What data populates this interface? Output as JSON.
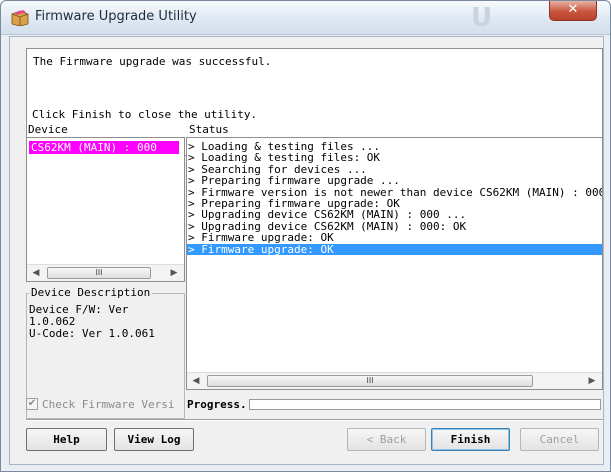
{
  "window": {
    "title": "Firmware Upgrade Utility"
  },
  "message": {
    "line1": "The Firmware upgrade was successful.",
    "line2": "Click Finish to close the utility."
  },
  "device_panel": {
    "label": "Device",
    "items": [
      "CS62KM (MAIN) : 000"
    ],
    "selected_color": "#ff00ff"
  },
  "status_panel": {
    "label": "Status",
    "lines": [
      "> Loading & testing files ...",
      "> Loading & testing files: OK",
      "> Searching for devices ...",
      "> Preparing firmware upgrade ...",
      "> Firmware version is not newer than device CS62KM (MAIN) : 000",
      "> Preparing firmware upgrade: OK",
      "> Upgrading device CS62KM (MAIN) : 000 ...",
      "> Upgrading device CS62KM (MAIN) : 000: OK",
      "> Firmware upgrade: OK",
      "> Firmware upgrade: OK"
    ],
    "selected_index": 9,
    "selected_color": "#3399ff"
  },
  "description": {
    "legend": "Device Description",
    "text": "Device F/W: Ver\n1.0.062\nU-Code: Ver 1.0.061"
  },
  "options": {
    "check_label": "Check Firmware Versi",
    "checked": true,
    "progress_label": "Progress.",
    "progress_fraction": 0.0
  },
  "buttons": {
    "help": "Help",
    "view_log": "View Log",
    "back": "< Back",
    "finish": "Finish",
    "cancel": "Cancel"
  },
  "scrollbar": {
    "grip": "III"
  }
}
